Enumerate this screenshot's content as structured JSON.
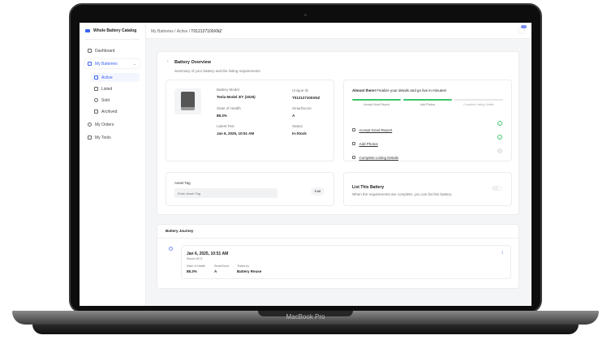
{
  "device": {
    "label": "MacBook Pro"
  },
  "app": {
    "title": "Whole Battery Catalog"
  },
  "sidebar": {
    "items": [
      {
        "label": "Dashboard"
      },
      {
        "label": "My Batteries"
      },
      {
        "label": "Active"
      },
      {
        "label": "Listed"
      },
      {
        "label": "Sold"
      },
      {
        "label": "Archived"
      },
      {
        "label": "My Orders"
      },
      {
        "label": "My Tools"
      }
    ]
  },
  "breadcrumb": [
    "My Batteries",
    "Active",
    "T012127100XNZ"
  ],
  "overview": {
    "title": "Battery Overview",
    "subtitle": "Summary of your battery and the listing requirements.",
    "fields": [
      {
        "label": "Battery Model",
        "value": "Tesla Model 3/Y (2025)"
      },
      {
        "label": "Unique ID",
        "value": "T012127100XNZ"
      },
      {
        "label": "State of Health",
        "value": "88.3%"
      },
      {
        "label": "SmartScore",
        "value": "A"
      },
      {
        "label": "Latest Test",
        "value": "Jan 6, 2025, 10:51 AM"
      },
      {
        "label": "Status",
        "value": "In-Stock"
      }
    ]
  },
  "progress": {
    "headline_bold": "Almost there!",
    "headline": "Finalize your details and go live in minutes!",
    "steps": [
      {
        "label": "Accept Good Report",
        "done": true
      },
      {
        "label": "Add Photos",
        "done": true
      },
      {
        "label": "Complete Listing Details",
        "done": false
      }
    ]
  },
  "asset_tag": {
    "label": "Asset Tag",
    "placeholder": "Enter Asset Tag",
    "button": "Edit"
  },
  "listing": {
    "title": "List This Battery",
    "description": "When the requirements are complete, you can list this battery.",
    "enabled": false
  },
  "journey": {
    "title": "Battery Journey",
    "entry": {
      "date": "Jan 6, 2025, 10:51 AM",
      "report": "Report #673",
      "fields": [
        {
          "label": "State of Health",
          "value": "88.3%"
        },
        {
          "label": "SmartScore",
          "value": "A"
        },
        {
          "label": "Tested by",
          "value": "Battery Reuse"
        }
      ]
    }
  },
  "colors": {
    "accent": "#3b63f6",
    "success": "#3cc46e"
  }
}
